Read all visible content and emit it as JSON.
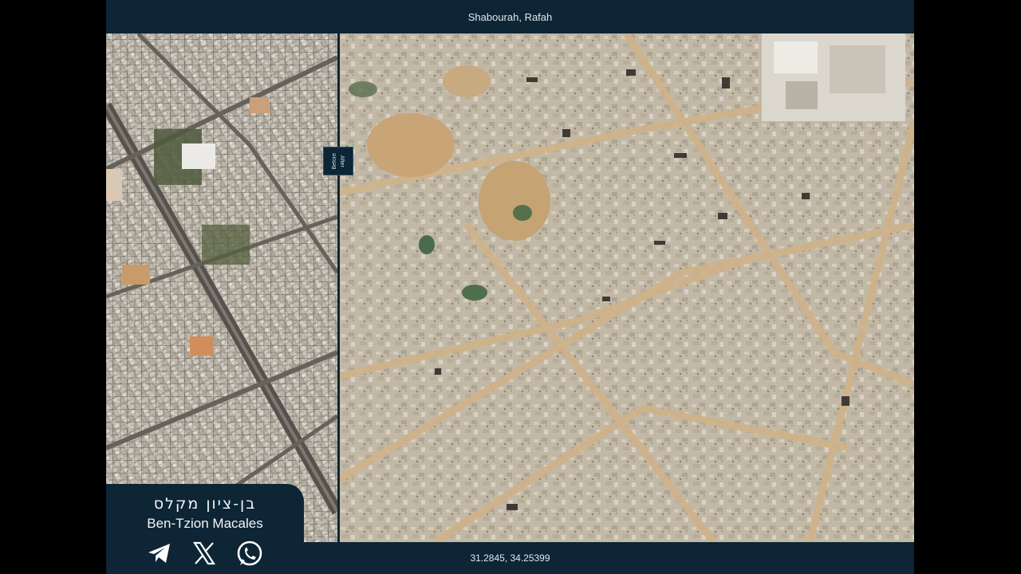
{
  "header": {
    "title": "Shabourah, Rafah"
  },
  "footer": {
    "coordinates": "31.2845, 34.25399"
  },
  "slider": {
    "before_label": "Before",
    "after_label": "After"
  },
  "credit": {
    "name_hebrew": "בן-ציון מקלס",
    "name_english": "Ben-Tzion Macales",
    "icons": [
      "telegram-icon",
      "x-icon",
      "whatsapp-icon"
    ]
  },
  "colors": {
    "panel": "#0d2535",
    "text": "#dfe8ee",
    "rubble": "#c3b8a4",
    "sand": "#c8a878"
  }
}
